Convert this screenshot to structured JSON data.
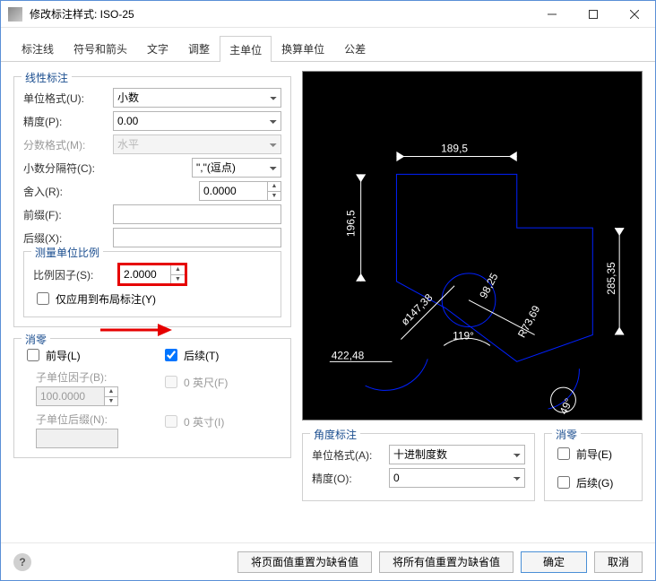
{
  "window": {
    "title": "修改标注样式: ISO-25"
  },
  "tabs": [
    "标注线",
    "符号和箭头",
    "文字",
    "调整",
    "主单位",
    "换算单位",
    "公差"
  ],
  "linear": {
    "legend": "线性标注",
    "unitFormat": {
      "label": "单位格式(U):",
      "value": "小数"
    },
    "precision": {
      "label": "精度(P):",
      "value": "0.00"
    },
    "fractionFormat": {
      "label": "分数格式(M):",
      "value": "水平"
    },
    "decimalSep": {
      "label": "小数分隔符(C):",
      "value": "\",\"(逗点)"
    },
    "round": {
      "label": "舍入(R):",
      "value": "0.0000"
    },
    "prefix": {
      "label": "前缀(F):",
      "value": ""
    },
    "suffix": {
      "label": "后缀(X):",
      "value": ""
    },
    "measureScale": {
      "legend": "测量单位比例",
      "scaleFactor": {
        "label": "比例因子(S):",
        "value": "2.0000"
      },
      "applyLayout": "仅应用到布局标注(Y)"
    }
  },
  "zero": {
    "legend": "消零",
    "leading": "前导(L)",
    "trailing": "后续(T)",
    "subFactor": {
      "label": "子单位因子(B):",
      "value": "100.0000"
    },
    "subSuffix": {
      "label": "子单位后缀(N):"
    },
    "feet": "0 英尺(F)",
    "inches": "0 英寸(I)"
  },
  "angle": {
    "legend": "角度标注",
    "unitFormat": {
      "label": "单位格式(A):",
      "value": "十进制度数"
    },
    "precision": {
      "label": "精度(O):",
      "value": "0"
    },
    "zero": {
      "legend": "消零",
      "leading": "前导(E)",
      "trailing": "后续(G)"
    }
  },
  "preview": {
    "d1": "189,5",
    "d2": "196,5",
    "d3": "285,35",
    "d4": "ø147,38",
    "d5": "98,25",
    "d6": "R73,69",
    "d7": "422,48",
    "d8": "119°",
    "d9": "49°"
  },
  "footer": {
    "resetPage": "将页面值重置为缺省值",
    "resetAll": "将所有值重置为缺省值",
    "ok": "确定",
    "cancel": "取消"
  }
}
